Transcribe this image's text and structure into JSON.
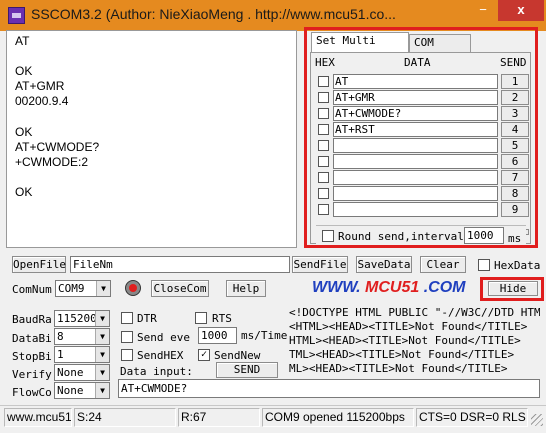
{
  "window": {
    "title": "SSCOM3.2 (Author: NieXiaoMeng .  http://www.mcu51.co...",
    "minimize": "−",
    "close": "x"
  },
  "receive": {
    "lines": [
      "AT",
      "",
      "OK",
      "AT+GMR",
      "00200.9.4",
      "",
      "OK",
      "AT+CWMODE?",
      "+CWMODE:2",
      "",
      "OK"
    ]
  },
  "multi_send": {
    "tabs": [
      "Set Multi Char",
      "COM DATA"
    ],
    "headers": {
      "hex": "HEX",
      "data": "DATA",
      "send": "SEND"
    },
    "rows": [
      {
        "data": "AT",
        "send": "1"
      },
      {
        "data": "AT+GMR",
        "send": "2"
      },
      {
        "data": "AT+CWMODE?",
        "send": "3"
      },
      {
        "data": "AT+RST",
        "send": "4"
      },
      {
        "data": "",
        "send": "5"
      },
      {
        "data": "",
        "send": "6"
      },
      {
        "data": "",
        "send": "7"
      },
      {
        "data": "",
        "send": "8"
      },
      {
        "data": "",
        "send": "9"
      }
    ],
    "partial_row_label": "10",
    "round_send_label": "Round send,interval:",
    "interval_value": "1000",
    "interval_unit": "ms"
  },
  "file_row": {
    "open_file": "OpenFile",
    "file_name": "FileNm",
    "send_file": "SendFile",
    "save_data": "SaveData",
    "clear": "Clear",
    "hex_data": "HexData"
  },
  "com_row": {
    "com_num_label": "ComNum",
    "com_num_value": "COM9",
    "close_com": "CloseCom",
    "help": "Help",
    "website_prefix": "WWW.",
    "website_brand": "MCU51",
    "website_suffix": ".COM",
    "hide": "Hide"
  },
  "settings": {
    "baud_label": "BaudRa",
    "baud_value": "115200",
    "data_bits_label": "DataBi",
    "data_bits_value": "8",
    "stop_bits_label": "StopBi",
    "stop_bits_value": "1",
    "verify_label": "Verify",
    "verify_value": "None",
    "flow_label": "FlowCo",
    "flow_value": "None"
  },
  "options": {
    "dtr": "DTR",
    "rts": "RTS",
    "send_every": "Send eve",
    "send_every_value": "1000",
    "send_every_unit": "ms/Time",
    "send_hex": "SendHEX",
    "send_new": "SendNew",
    "data_input_label": "Data input:",
    "send_button": "SEND",
    "data_input_value": "AT+CWMODE?"
  },
  "html_preview": {
    "lines": [
      "<!DOCTYPE HTML PUBLIC \"-//W3C//DTD HTML 4.",
      "<HTML><HEAD><TITLE>Not Found</TITLE>",
      "HTML><HEAD><TITLE>Not Found</TITLE>",
      "TML><HEAD><TITLE>Not Found</TITLE>",
      "ML><HEAD><TITLE>Not Found</TITLE>"
    ]
  },
  "status_bar": {
    "site": "www.mcu51.cor",
    "sent": "S:24",
    "received": "R:67",
    "port_status": "COM9 opened 115200bps",
    "signals": "CTS=0 DSR=0 RLS"
  },
  "colors": {
    "titlebar": "#e58a1f",
    "highlight": "#e01e1e",
    "website": "#1f3fbf"
  }
}
